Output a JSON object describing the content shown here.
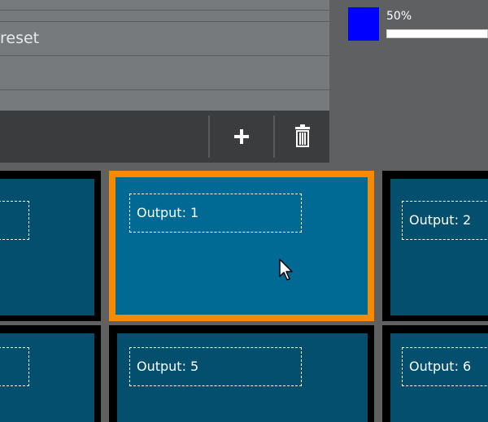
{
  "preset_list": {
    "selected_label": "reset"
  },
  "toolbar": {
    "add_icon": "plus-icon",
    "delete_icon": "trash-icon"
  },
  "color": {
    "swatch_hex": "#0000ff",
    "level_label": "50%",
    "level_value": 0.5
  },
  "outputs": {
    "accent_color": "#f88a00",
    "tiles": [
      {
        "label": ""
      },
      {
        "label": "Output: 1"
      },
      {
        "label": "Output: 2"
      },
      {
        "label": ""
      },
      {
        "label": "Output: 5"
      },
      {
        "label": "Output: 6"
      }
    ]
  }
}
